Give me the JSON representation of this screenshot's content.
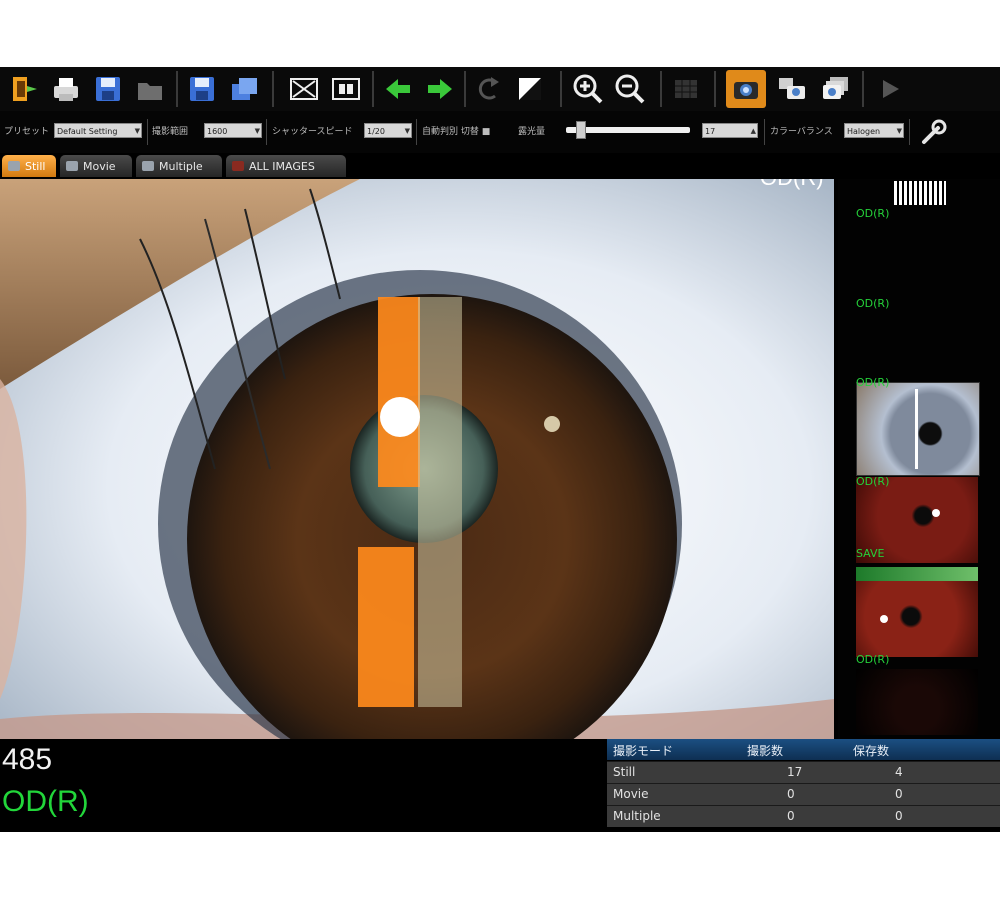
{
  "toolbar": {
    "icons": [
      "exit-icon",
      "print-icon",
      "save-icon",
      "open-folder-icon",
      "save-as-icon",
      "export-icon",
      "close-image-icon",
      "compare-icon",
      "previous-arrow-icon",
      "next-arrow-icon",
      "rotate-icon",
      "contrast-icon",
      "zoom-in-icon",
      "zoom-out-icon",
      "grid-layout-icon",
      "camera-icon",
      "camera-settings-icon",
      "capture-multiple-icon",
      "play-icon",
      "wrench-icon"
    ]
  },
  "settings": {
    "preset_label": "プリセット",
    "preset_value": "Default Setting",
    "range_label": "撮影範囲",
    "range_value": "1600",
    "shutter_label": "シャッタースピード",
    "shutter_value": "1/20",
    "auto_label": "自動判別 切替 ■",
    "exposure_label": "露光量",
    "exposure_value": "17",
    "color_label": "カラーバランス",
    "color_value": "Halogen"
  },
  "tabs": [
    {
      "label": "Still"
    },
    {
      "label": "Movie"
    },
    {
      "label": "Multiple"
    },
    {
      "label": "ALL IMAGES"
    }
  ],
  "main_image": {
    "overlay_label": "OD(R)"
  },
  "thumbnails": [
    {
      "label": "OD(R)"
    },
    {
      "label": "OD(R)"
    },
    {
      "label": "OD(R)"
    },
    {
      "label": "OD(R)"
    },
    {
      "label": "SAVE"
    },
    {
      "label": "OD(R)"
    }
  ],
  "status": {
    "frame_number": "485",
    "eye_label": "OD(R)"
  },
  "stats_table": {
    "headers": [
      "撮影モード",
      "撮影数",
      "保存数"
    ],
    "rows": [
      {
        "mode": "Still",
        "taken": "17",
        "saved": "4"
      },
      {
        "mode": "Movie",
        "taken": "0",
        "saved": "0"
      },
      {
        "mode": "Multiple",
        "taken": "0",
        "saved": "0"
      }
    ]
  },
  "colors": {
    "accent_orange": "#e08a1a",
    "label_green": "#22d63a",
    "table_header_blue": "#1b4f82"
  }
}
